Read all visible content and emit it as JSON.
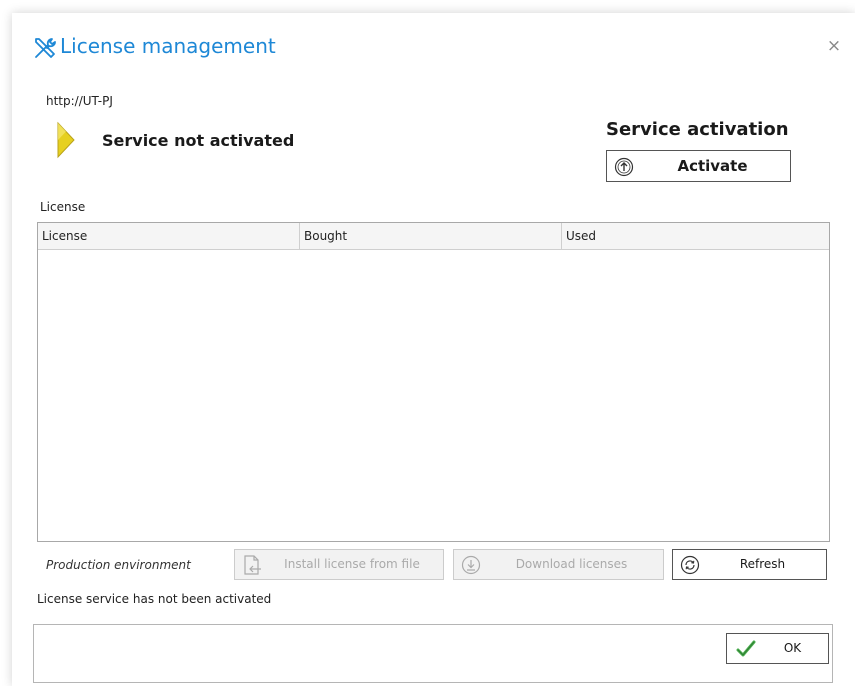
{
  "window": {
    "title": "License management",
    "close_symbol": "×"
  },
  "server": {
    "url": "http://UT-PJ"
  },
  "status": {
    "message": "Service not activated",
    "flag_color": "#e6d020"
  },
  "activation": {
    "heading": "Service activation",
    "button_label": "Activate"
  },
  "license_section": {
    "label": "License",
    "columns": [
      "License",
      "Bought",
      "Used"
    ],
    "rows": []
  },
  "toolbar": {
    "environment_label": "Production environment",
    "install_label": "Install license from file",
    "download_label": "Download licenses",
    "refresh_label": "Refresh"
  },
  "status_line": "License service has not been activated",
  "footer": {
    "ok_label": "OK"
  },
  "colors": {
    "accent": "#1e88d6",
    "ok_check": "#4caf50",
    "disabled_text": "#aaaaaa"
  },
  "icons": {
    "title": "tools-icon",
    "status": "flag-icon",
    "activate": "upload-arrow-icon",
    "install": "file-import-icon",
    "download": "download-arrow-icon",
    "refresh": "refresh-icon",
    "ok": "checkmark-icon"
  }
}
